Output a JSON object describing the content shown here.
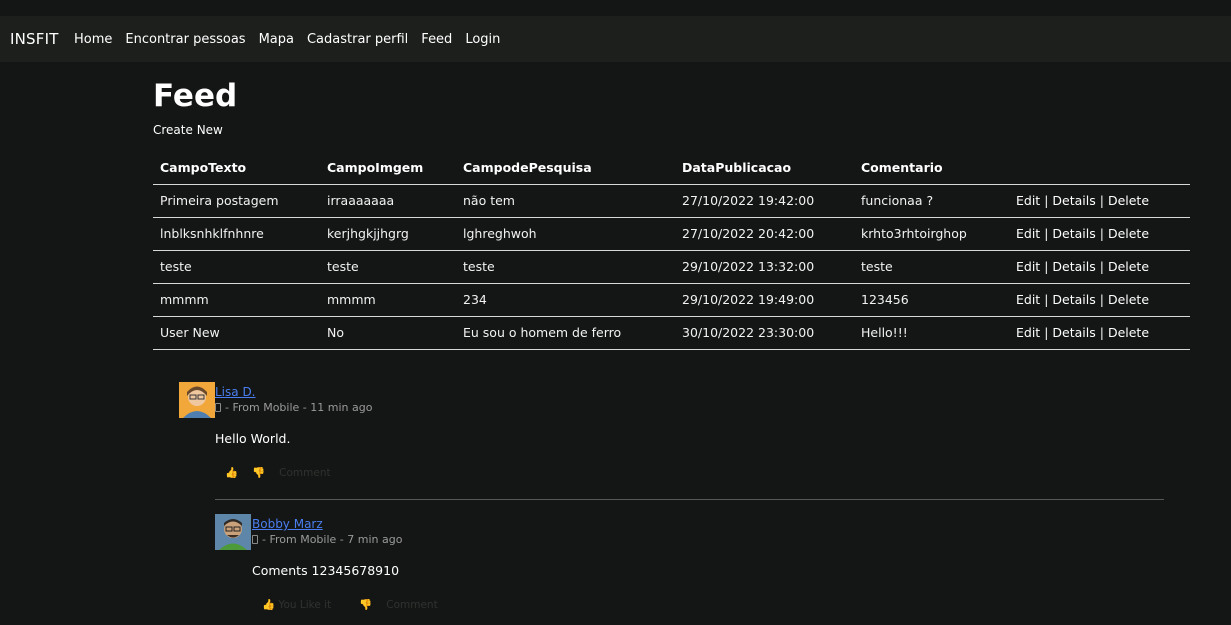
{
  "nav": {
    "brand": "INSFIT",
    "links": [
      "Home",
      "Encontrar pessoas",
      "Mapa",
      "Cadastrar perfil",
      "Feed",
      "Login"
    ]
  },
  "page": {
    "title": "Feed",
    "create_new": "Create New"
  },
  "table": {
    "headers": [
      "CampoTexto",
      "CampoImgem",
      "CampodePesquisa",
      "DataPublicacao",
      "Comentario"
    ],
    "rows": [
      [
        "Primeira postagem",
        "irraaaaaaa",
        "não tem",
        "27/10/2022 19:42:00",
        "funcionaa ?"
      ],
      [
        "lnblksnhklfnhnre",
        "kerjhgkjjhgrg",
        "lghreghwoh",
        "27/10/2022 20:42:00",
        "krhto3rhtoirghop"
      ],
      [
        "teste",
        "teste",
        "teste",
        "29/10/2022 13:32:00",
        "teste"
      ],
      [
        "mmmm",
        "mmmm",
        "234",
        "29/10/2022 19:49:00",
        "123456"
      ],
      [
        "User New",
        "No",
        "Eu sou o homem de ferro",
        "30/10/2022 23:30:00",
        "Hello!!!"
      ]
    ],
    "actions": {
      "edit": "Edit",
      "details": "Details",
      "delete": "Delete",
      "separator": "|"
    }
  },
  "comments": [
    {
      "author": "Lisa D.",
      "meta": "- From Mobile - 11 min ago",
      "text": "Hello World.",
      "like_label": "",
      "comment_label": "Comment"
    },
    {
      "author": "Bobby Marz",
      "meta": "- From Mobile - 7 min ago",
      "text": "Coments 12345678910",
      "like_label": "You Like it",
      "comment_label": "Comment"
    }
  ],
  "colors": {
    "background": "#141615",
    "navbar": "#1c1f1c",
    "link_author": "#4a7ef0",
    "muted": "#9a9a9a"
  }
}
